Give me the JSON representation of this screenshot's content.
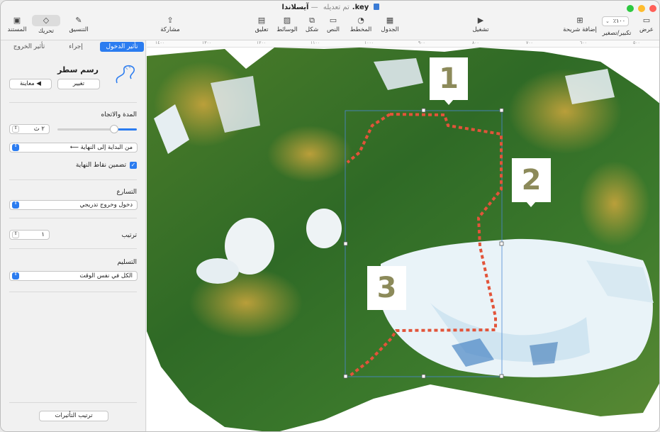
{
  "window": {
    "file_name": "آيسلاندا.key",
    "status": "تم تعديله",
    "separator": "—"
  },
  "toolbar": {
    "view": "عرض",
    "zoom": "تكبير/تصغير",
    "zoom_value": "٪١٠٠",
    "add_slide": "إضافة شريحة",
    "play": "تشغيل",
    "table": "الجدول",
    "chart": "المخطط",
    "text": "النص",
    "shape": "شكل",
    "media": "الوسائط",
    "comment": "تعليق",
    "share": "مشاركة",
    "format": "التنسيق",
    "animate": "تحريك",
    "document": "المستند"
  },
  "inspector": {
    "tabs": {
      "build_in": "تأثير الدخول",
      "action": "إجراء",
      "build_out": "تأثير الخروج"
    },
    "effect_name": "رسم سطر",
    "change_button": "تغيير",
    "preview_button": "معاينة ◀",
    "duration_heading": "المدة والاتجاه",
    "duration_value": "٢ ث",
    "direction_value": "⟵ من البداية إلى النهاية",
    "include_endpoints": "تضمين نقاط النهاية",
    "acceleration_heading": "التسارع",
    "acceleration_value": "دخول وخروج تدريجي",
    "order_label": "ترتيب",
    "order_value": "١",
    "delivery_heading": "التسليم",
    "delivery_value": "الكل في نفس الوقت",
    "build_order_button": "ترتيب التأثيرات"
  },
  "ruler": [
    "١٤٠٠",
    "١٣٠٠",
    "١٢٠٠",
    "١١٠٠",
    "١٠٠٠",
    "٩٠٠",
    "٨٠٠",
    "٧٠٠",
    "٦٠٠",
    "٥٠٠"
  ],
  "callouts": [
    "1",
    "2",
    "3"
  ],
  "colors": {
    "accent": "#2b7cf0",
    "path": "#e2543a",
    "callout_text": "#8c8a5a"
  }
}
